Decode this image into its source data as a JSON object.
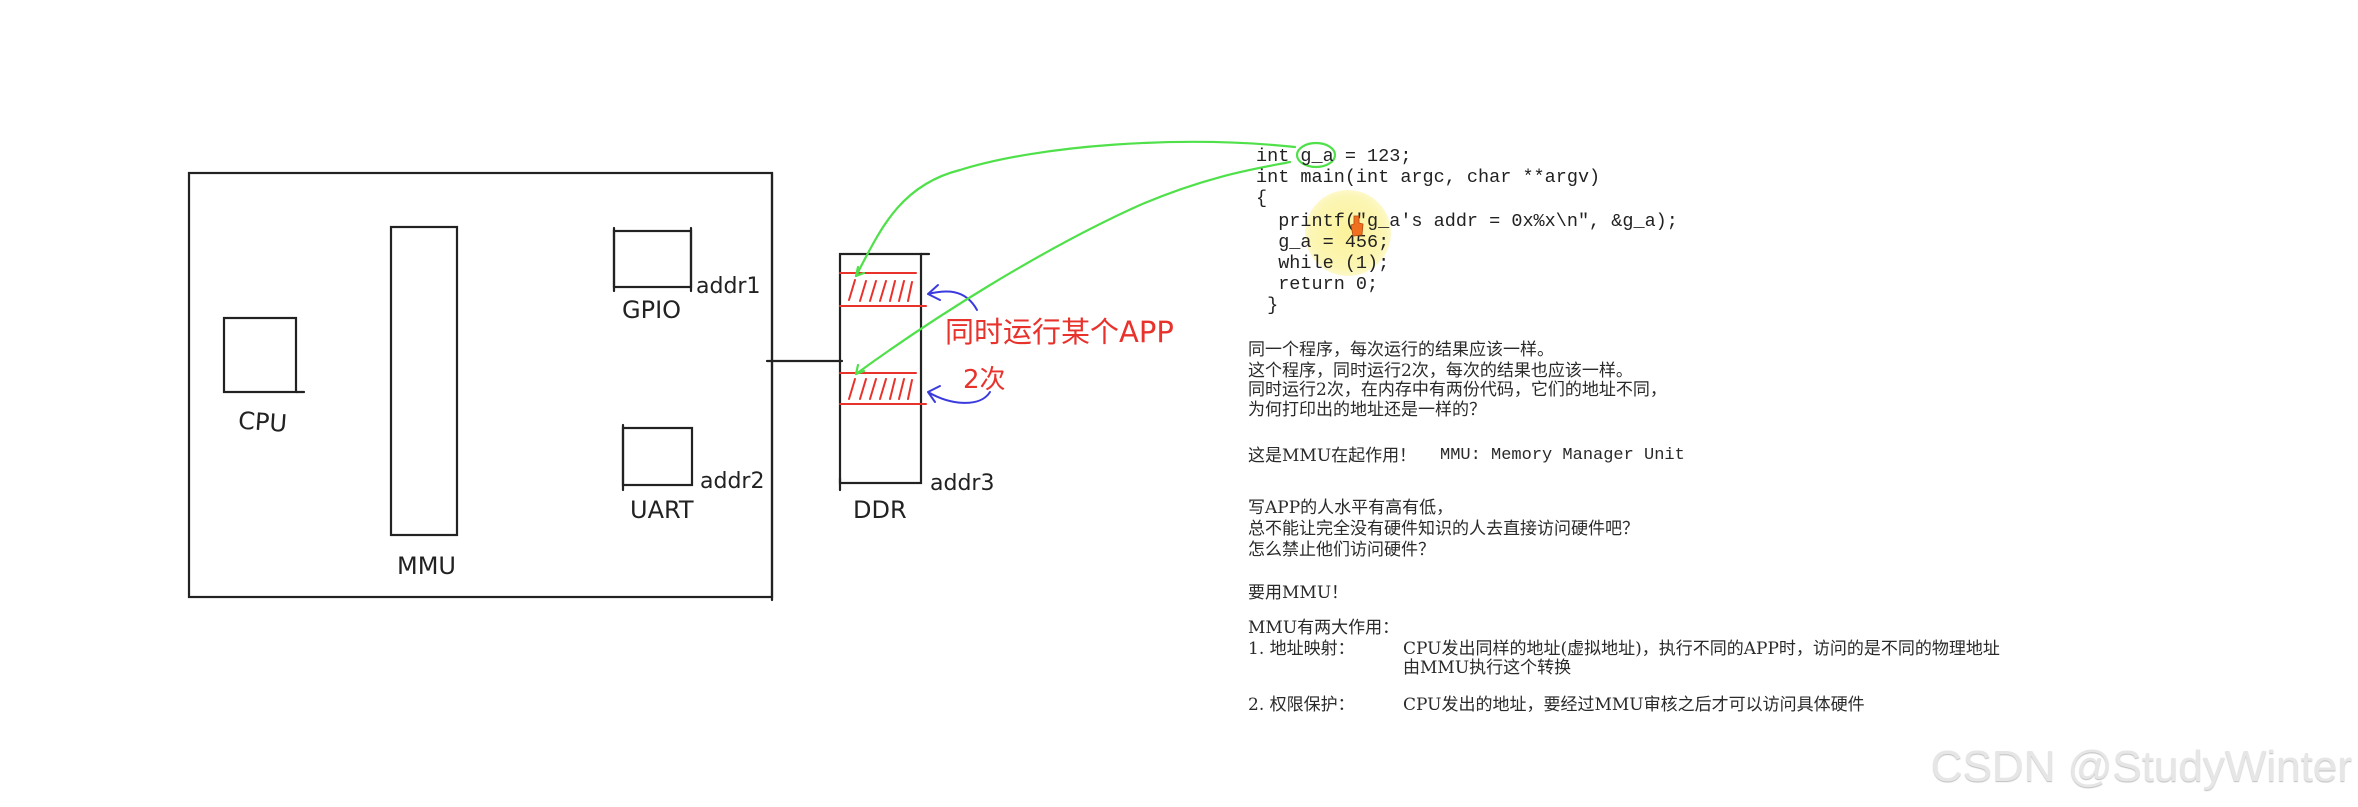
{
  "diagram": {
    "soc_box": {
      "label": ""
    },
    "cpu": {
      "label": "CPU"
    },
    "mmu": {
      "label": "MMU"
    },
    "gpio": {
      "label": "GPIO",
      "addr": "addr1"
    },
    "uart": {
      "label": "UART",
      "addr": "addr2"
    },
    "ddr": {
      "label": "DDR",
      "addr": "addr3"
    },
    "annotation": {
      "line1": "同时运行某个APP",
      "line2": "2次"
    },
    "colors": {
      "ink": "#222222",
      "code_copy": "#e8322c",
      "pointer_arrow": "#3a3adf",
      "mapping_line": "#4fe04a",
      "highlight": "#faee78",
      "cursor": "#f07020"
    }
  },
  "code": {
    "lines": [
      "int g_a = 123;",
      "int main(int argc, char **argv)",
      "{",
      "  printf(\"g_a's addr = 0x%x\\n\", &g_a);",
      "  g_a = 456;",
      "  while (1);",
      "  return 0;",
      " }"
    ]
  },
  "notes": {
    "para1": [
      "同一个程序，每次运行的结果应该一样。",
      "这个程序，同时运行2次，每次的结果也应该一样。",
      "同时运行2次，在内存中有两份代码，它们的地址不同，",
      "为何打印出的地址还是一样的？"
    ],
    "para2_prefix": "这是MMU在起作用！",
    "para2_suffix": "MMU: Memory Manager Unit",
    "para3": [
      "写APP的人水平有高有低，",
      "总不能让完全没有硬件知识的人去直接访问硬件吧？",
      "怎么禁止他们访问硬件？"
    ],
    "para4": "要用MMU！",
    "para5_title": "MMU有两大作用：",
    "item1_label": "1. 地址映射：",
    "item1_text": "CPU发出同样的地址(虚拟地址)，执行不同的APP时，访问的是不同的物理地址",
    "item1_cont": "由MMU执行这个转换",
    "item2_label": "2. 权限保护：",
    "item2_text": "CPU发出的地址，要经过MMU审核之后才可以访问具体硬件"
  },
  "watermark": "CSDN @StudyWinter"
}
